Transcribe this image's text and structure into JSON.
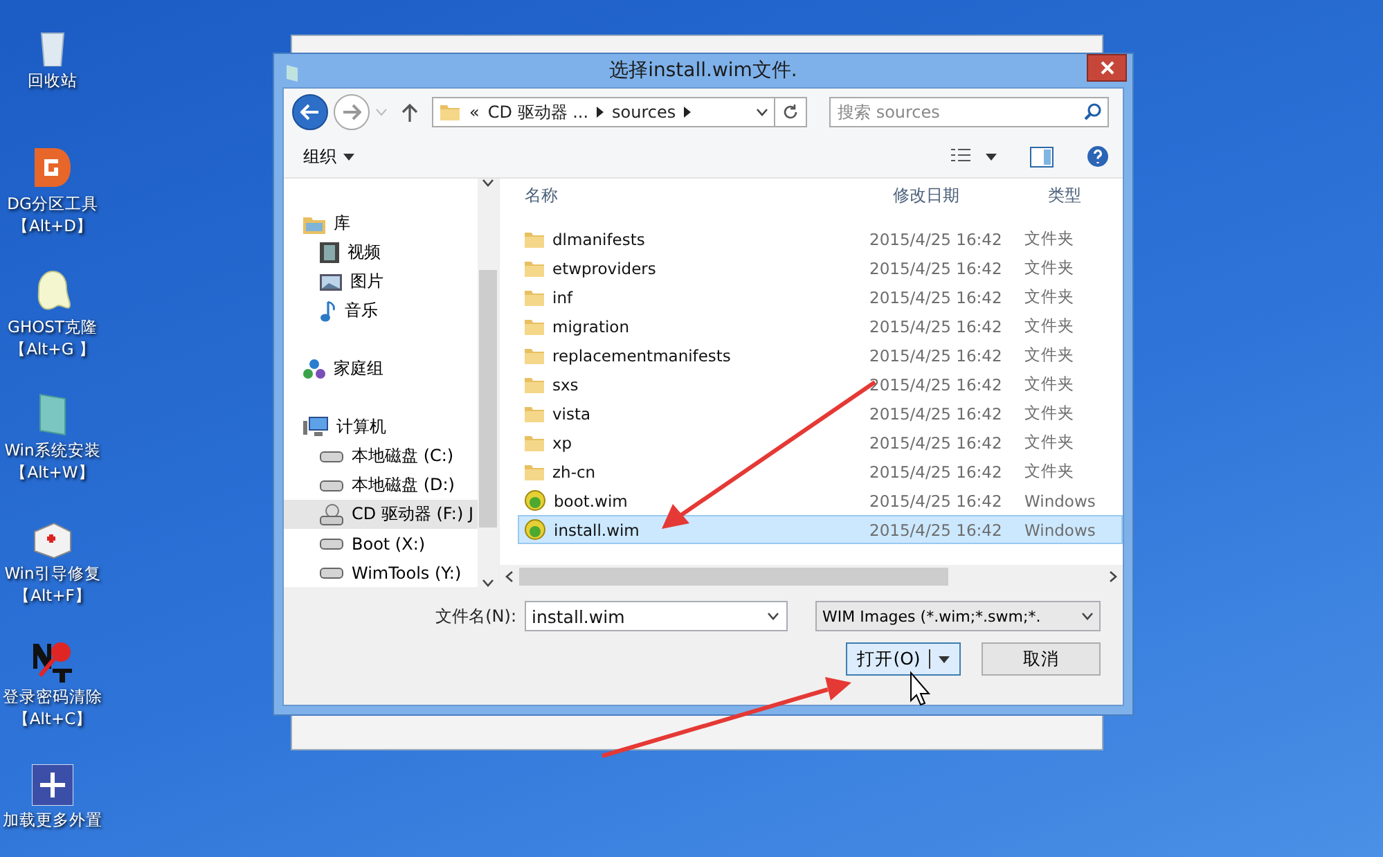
{
  "desktop_icons": [
    {
      "kind": "recycle",
      "label": "回收站"
    },
    {
      "kind": "diskgenius",
      "label": "DG分区工具",
      "hotkey": "【Alt+D】"
    },
    {
      "kind": "ghost",
      "label": "GHOST克隆",
      "hotkey": "【Alt+G 】"
    },
    {
      "kind": "install",
      "label": "Win系统安装",
      "hotkey": "【Alt+W】"
    },
    {
      "kind": "repair",
      "label": "Win引导修复",
      "hotkey": "【Alt+F】"
    },
    {
      "kind": "password",
      "label": "登录密码清除",
      "hotkey": "【Alt+C】"
    },
    {
      "kind": "load",
      "label": "加载更多外置"
    }
  ],
  "dialog": {
    "title": "选择install.wim文件.",
    "address": {
      "prefix": "«",
      "segments": [
        "CD 驱动器 ...",
        "sources"
      ]
    },
    "search": {
      "placeholder": "搜索 sources"
    },
    "toolbar": {
      "organize": "组织"
    },
    "sidebar": [
      {
        "kind": "library",
        "label": "库",
        "selected": false,
        "children": [
          {
            "kind": "video",
            "label": "视频",
            "selected": false
          },
          {
            "kind": "picture",
            "label": "图片",
            "selected": false
          },
          {
            "kind": "music",
            "label": "音乐",
            "selected": false
          }
        ]
      },
      {
        "kind": "homegroup",
        "label": "家庭组",
        "selected": false
      },
      {
        "kind": "computer",
        "label": "计算机",
        "selected": false,
        "children": [
          {
            "kind": "disk",
            "label": "本地磁盘 (C:)",
            "selected": false
          },
          {
            "kind": "disk",
            "label": "本地磁盘 (D:)",
            "selected": false
          },
          {
            "kind": "cd",
            "label": "CD 驱动器 (F:) J",
            "selected": true
          },
          {
            "kind": "disk",
            "label": "Boot (X:)",
            "selected": false
          },
          {
            "kind": "disk",
            "label": "WimTools (Y:)",
            "selected": false
          }
        ]
      }
    ],
    "columns": [
      "名称",
      "修改日期",
      "类型"
    ],
    "files": [
      {
        "kind": "folder",
        "name": "dlmanifests",
        "date": "2015/4/25 16:42",
        "type": "文件夹",
        "selected": false
      },
      {
        "kind": "folder",
        "name": "etwproviders",
        "date": "2015/4/25 16:42",
        "type": "文件夹",
        "selected": false
      },
      {
        "kind": "folder",
        "name": "inf",
        "date": "2015/4/25 16:42",
        "type": "文件夹",
        "selected": false
      },
      {
        "kind": "folder",
        "name": "migration",
        "date": "2015/4/25 16:42",
        "type": "文件夹",
        "selected": false
      },
      {
        "kind": "folder",
        "name": "replacementmanifests",
        "date": "2015/4/25 16:42",
        "type": "文件夹",
        "selected": false
      },
      {
        "kind": "folder",
        "name": "sxs",
        "date": "2015/4/25 16:42",
        "type": "文件夹",
        "selected": false
      },
      {
        "kind": "folder",
        "name": "vista",
        "date": "2015/4/25 16:42",
        "type": "文件夹",
        "selected": false
      },
      {
        "kind": "folder",
        "name": "xp",
        "date": "2015/4/25 16:42",
        "type": "文件夹",
        "selected": false
      },
      {
        "kind": "folder",
        "name": "zh-cn",
        "date": "2015/4/25 16:42",
        "type": "文件夹",
        "selected": false
      },
      {
        "kind": "wim",
        "name": "boot.wim",
        "date": "2015/4/25 16:42",
        "type": "Windows",
        "selected": false
      },
      {
        "kind": "wim",
        "name": "install.wim",
        "date": "2015/4/25 16:42",
        "type": "Windows",
        "selected": true
      }
    ],
    "filename_label": "文件名(N):",
    "filename_value": "install.wim",
    "filetype_value": "WIM Images (*.wim;*.swm;*.",
    "open_button": "打开(O)",
    "cancel_button": "取消"
  }
}
